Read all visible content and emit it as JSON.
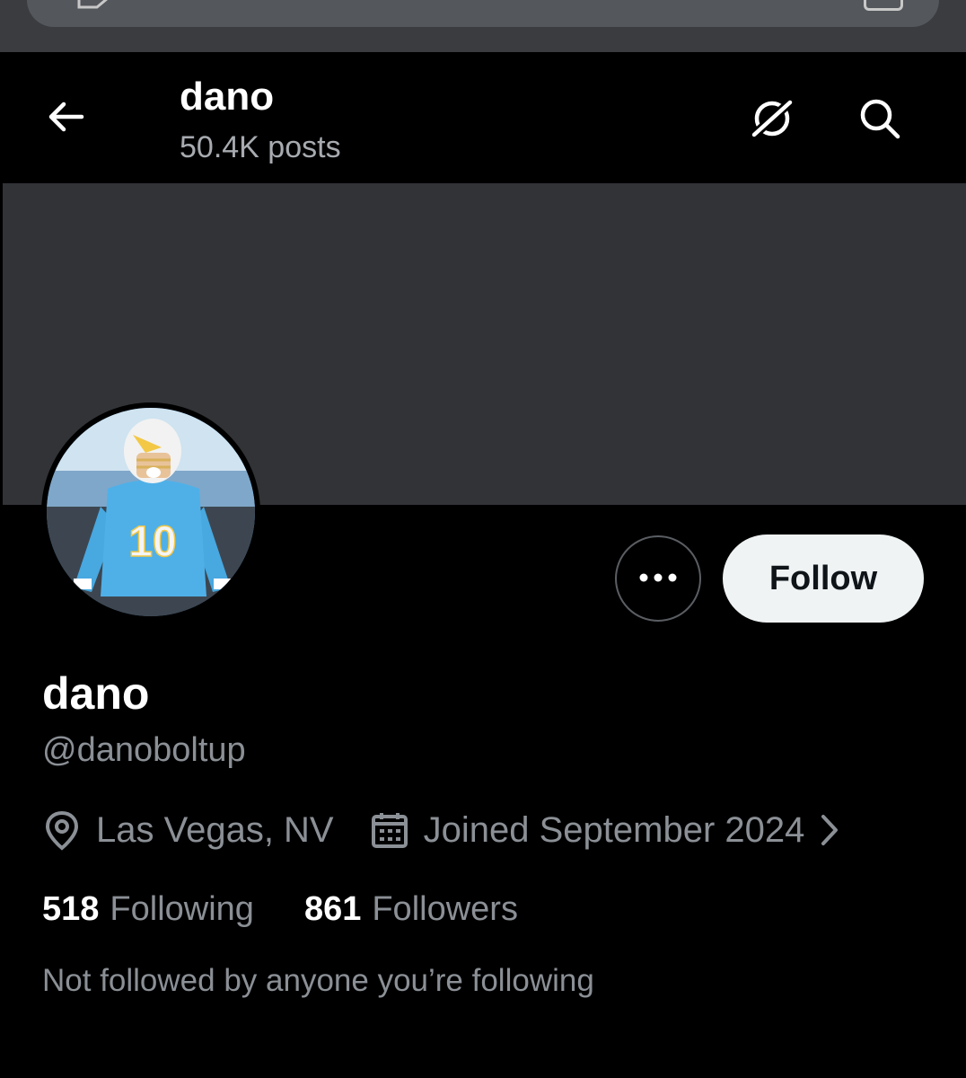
{
  "header": {
    "title": "dano",
    "posts": "50.4K posts"
  },
  "profile": {
    "display_name": "dano",
    "handle": "@danoboltup",
    "location": "Las Vegas, NV",
    "joined": "Joined September 2024",
    "following_count": "518",
    "following_label": "Following",
    "followers_count": "861",
    "followers_label": "Followers",
    "mutual_text": "Not followed by anyone you’re following",
    "avatar_jersey_number": "10"
  },
  "actions": {
    "follow_label": "Follow"
  },
  "icons": {
    "back": "arrow-left-icon",
    "grok": "grok-icon",
    "search": "search-icon",
    "more": "more-horizontal-icon",
    "location": "location-pin-icon",
    "calendar": "calendar-icon",
    "chevron": "chevron-right-icon"
  },
  "colors": {
    "background": "#000000",
    "banner": "#313336",
    "muted_text": "#8b9096",
    "follow_button_bg": "#eff3f4"
  }
}
